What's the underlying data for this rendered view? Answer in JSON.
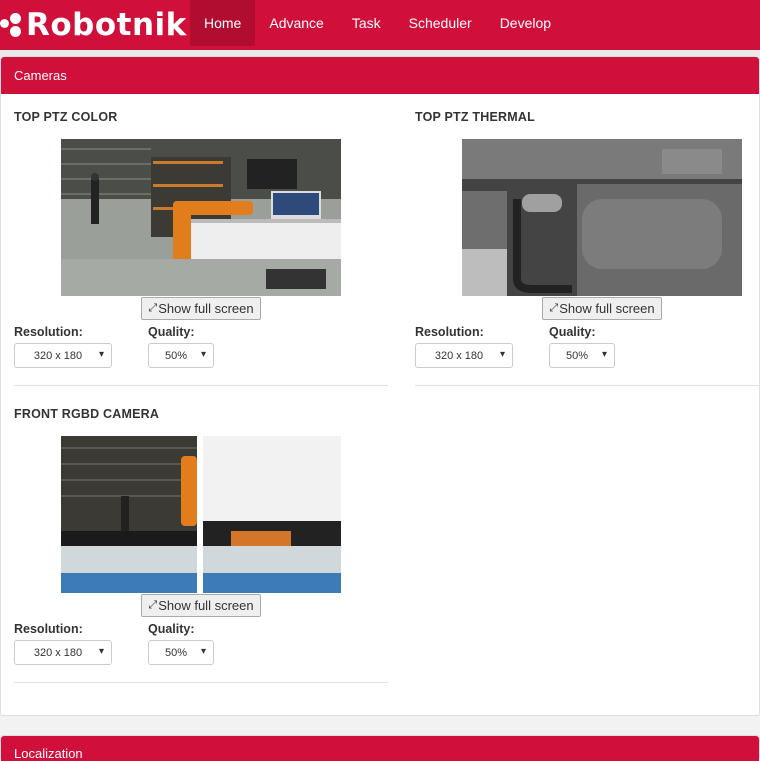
{
  "brand": {
    "name": "Robotnik",
    "color": "#d0103a"
  },
  "nav": {
    "items": [
      {
        "label": "Home",
        "active": true
      },
      {
        "label": "Advance",
        "active": false
      },
      {
        "label": "Task",
        "active": false
      },
      {
        "label": "Scheduler",
        "active": false
      },
      {
        "label": "Develop",
        "active": false
      }
    ]
  },
  "cameras_panel": {
    "title": "Cameras",
    "cameras": [
      {
        "title": "TOP PTZ COLOR",
        "fullscreen_label": "Show full screen",
        "resolution_label": "Resolution:",
        "resolution_value": "320 x 180",
        "quality_label": "Quality:",
        "quality_value": "50%"
      },
      {
        "title": "TOP PTZ THERMAL",
        "fullscreen_label": "Show full screen",
        "resolution_label": "Resolution:",
        "resolution_value": "320 x 180",
        "quality_label": "Quality:",
        "quality_value": "50%"
      },
      {
        "title": "FRONT RGBD CAMERA",
        "fullscreen_label": "Show full screen",
        "resolution_label": "Resolution:",
        "resolution_value": "320 x 180",
        "quality_label": "Quality:",
        "quality_value": "50%"
      }
    ]
  },
  "localization_panel": {
    "title": "Localization"
  },
  "icons": {
    "fullscreen": "expand-arrows-icon",
    "dropdown": "chevron-down-icon"
  }
}
